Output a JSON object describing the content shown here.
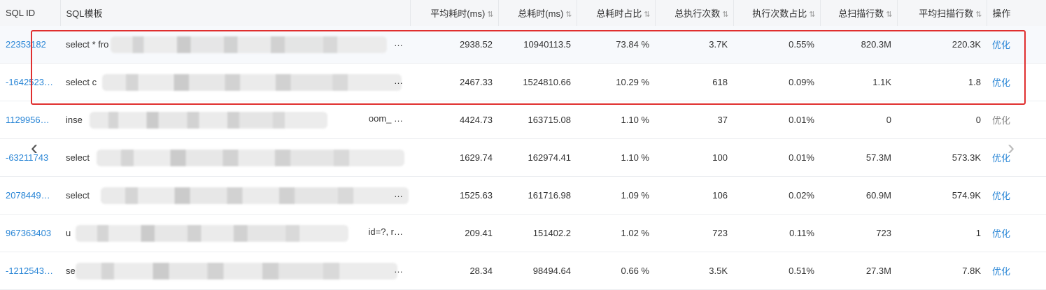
{
  "columns": [
    {
      "label": "SQL ID",
      "sortable": false
    },
    {
      "label": "SQL模板",
      "sortable": false
    },
    {
      "label": "平均耗时(ms)",
      "sortable": true
    },
    {
      "label": "总耗时(ms)",
      "sortable": true
    },
    {
      "label": "总耗时占比",
      "sortable": true
    },
    {
      "label": "总执行次数",
      "sortable": true
    },
    {
      "label": "执行次数占比",
      "sortable": true
    },
    {
      "label": "总扫描行数",
      "sortable": true
    },
    {
      "label": "平均扫描行数",
      "sortable": true
    },
    {
      "label": "操作",
      "sortable": false
    }
  ],
  "sort_icon": "⇅",
  "rows": [
    {
      "sql_id": "22353182",
      "tpl_head": "select * fro",
      "tpl_tail": "…",
      "avg_time": "2938.52",
      "total_time": "10940113.5",
      "time_pct": "73.84 %",
      "exec_count": "3.7K",
      "exec_pct": "0.55%",
      "scan_rows": "820.3M",
      "avg_scan": "220.3K",
      "action": "优化"
    },
    {
      "sql_id": "-1642523…",
      "tpl_head": "select c",
      "tpl_tail": "…",
      "avg_time": "2467.33",
      "total_time": "1524810.66",
      "time_pct": "10.29 %",
      "exec_count": "618",
      "exec_pct": "0.09%",
      "scan_rows": "1.1K",
      "avg_scan": "1.8",
      "action": "优化"
    },
    {
      "sql_id": "1129956…",
      "tpl_head": "inse",
      "tpl_tail": "oom_ …",
      "avg_time": "4424.73",
      "total_time": "163715.08",
      "time_pct": "1.10 %",
      "exec_count": "37",
      "exec_pct": "0.01%",
      "scan_rows": "0",
      "avg_scan": "0",
      "action": "优化"
    },
    {
      "sql_id": "-63211743",
      "tpl_head": "select",
      "tpl_tail": "",
      "avg_time": "1629.74",
      "total_time": "162974.41",
      "time_pct": "1.10 %",
      "exec_count": "100",
      "exec_pct": "0.01%",
      "scan_rows": "57.3M",
      "avg_scan": "573.3K",
      "action": "优化"
    },
    {
      "sql_id": "2078449…",
      "tpl_head": "select",
      "tpl_tail": "…",
      "avg_time": "1525.63",
      "total_time": "161716.98",
      "time_pct": "1.09 %",
      "exec_count": "106",
      "exec_pct": "0.02%",
      "scan_rows": "60.9M",
      "avg_scan": "574.9K",
      "action": "优化"
    },
    {
      "sql_id": "967363403",
      "tpl_head": "u",
      "tpl_tail": "id=?, r…",
      "avg_time": "209.41",
      "total_time": "151402.2",
      "time_pct": "1.02 %",
      "exec_count": "723",
      "exec_pct": "0.11%",
      "scan_rows": "723",
      "avg_scan": "1",
      "action": "优化"
    },
    {
      "sql_id": "-1212543…",
      "tpl_head": "se",
      "tpl_tail": "…",
      "avg_time": "28.34",
      "total_time": "98494.64",
      "time_pct": "0.66 %",
      "exec_count": "3.5K",
      "exec_pct": "0.51%",
      "scan_rows": "27.3M",
      "avg_scan": "7.8K",
      "action": "优化"
    }
  ],
  "nav": {
    "prev": "‹",
    "next": "›"
  },
  "colors": {
    "link": "#2a86d6",
    "highlight_border": "#e02f2f",
    "header_bg": "#f5f6f8"
  }
}
